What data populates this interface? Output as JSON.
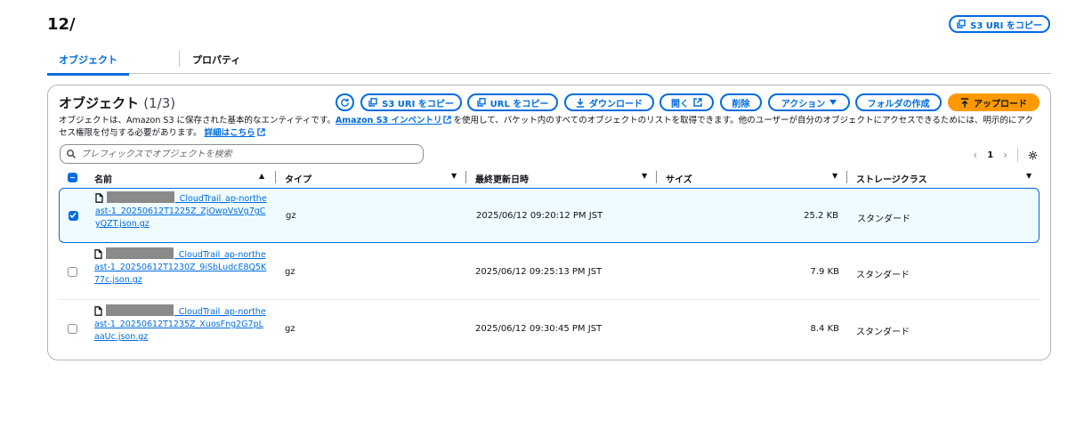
{
  "header": {
    "title": "12/",
    "copy_s3_uri": "S3 URI をコピー"
  },
  "tabs": [
    {
      "label": "オブジェクト",
      "active": true
    },
    {
      "label": "プロパティ",
      "active": false
    }
  ],
  "objects_panel": {
    "title": "オブジェクト",
    "count": "(1/3)",
    "toolbar": {
      "copy_s3_uri": "S3 URI をコピー",
      "copy_url": "URL をコピー",
      "download": "ダウンロード",
      "open": "開く",
      "delete": "削除",
      "actions": "アクション",
      "create_folder": "フォルダの作成",
      "upload": "アップロード"
    },
    "description": {
      "part1": "オブジェクトは、Amazon S3 に保存された基本的なエンティティです。",
      "link1": "Amazon S3 インベントリ",
      "part2": "を使用して、バケット内のすべてのオブジェクトのリストを取得できます。他のユーザーが自分のオブジェクトにアクセスできるためには、明示的にアクセス権限を付与する必要があります。",
      "link2": "詳細はこちら"
    },
    "search": {
      "placeholder": "プレフィックスでオブジェクトを検索",
      "value": ""
    },
    "pagination": {
      "current_page": "1"
    },
    "columns": [
      "名前",
      "タイプ",
      "最終更新日時",
      "サイズ",
      "ストレージクラス"
    ],
    "rows": [
      {
        "selected": true,
        "name_suffix": "_CloudTrail_ap-northeast-1_20250612T1225Z_ZjOwpVsVg7gCyQZT.json.gz",
        "type": "gz",
        "last_modified": "2025/06/12 09:20:12 PM JST",
        "size": "25.2 KB",
        "storage_class": "スタンダード"
      },
      {
        "selected": false,
        "name_suffix": "_CloudTrail_ap-northeast-1_20250612T1230Z_9iSbLudcE8Q5K77c.json.gz",
        "type": "gz",
        "last_modified": "2025/06/12 09:25:13 PM JST",
        "size": "7.9 KB",
        "storage_class": "スタンダード"
      },
      {
        "selected": false,
        "name_suffix": "_CloudTrail_ap-northeast-1_20250612T1235Z_XuosFng2G7pLaaUc.json.gz",
        "type": "gz",
        "last_modified": "2025/06/12 09:30:45 PM JST",
        "size": "8.4 KB",
        "storage_class": "スタンダード"
      }
    ]
  },
  "colors": {
    "link": "#006ce0",
    "primary": "#ff9900",
    "selected_row_bg": "#f0fbff",
    "border": "#b4b4bb"
  },
  "icons": [
    "copy-icon",
    "refresh-icon",
    "download-icon",
    "external-link-icon",
    "caret-down-icon",
    "upload-icon",
    "search-icon",
    "gear-icon",
    "file-icon",
    "chevron-left-icon",
    "chevron-right-icon",
    "sort-icon"
  ]
}
